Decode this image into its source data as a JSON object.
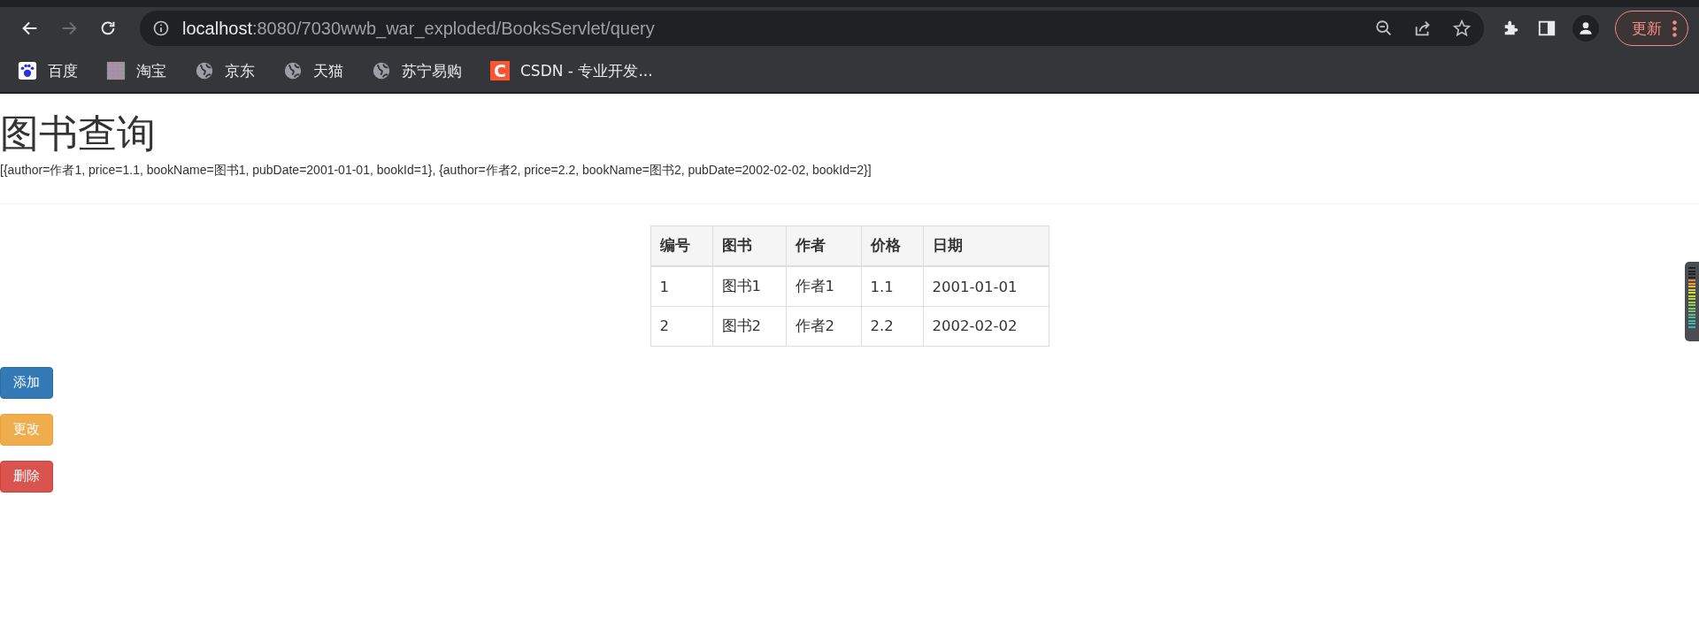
{
  "browser": {
    "address": {
      "host": "localhost",
      "path": ":8080/7030wwb_war_exploded/BooksServlet/query"
    },
    "forward_disabled": true,
    "bookmarks": [
      {
        "label": "百度",
        "kind": "paw"
      },
      {
        "label": "淘宝",
        "kind": "tile"
      },
      {
        "label": "京东",
        "kind": "globe"
      },
      {
        "label": "天猫",
        "kind": "globe"
      },
      {
        "label": "苏宁易购",
        "kind": "globe"
      },
      {
        "label": "CSDN - 专业开发...",
        "kind": "letter",
        "icon_text": "C"
      }
    ],
    "update_button": "更新"
  },
  "page": {
    "title": "图书查询",
    "dump": "[{author=作者1, price=1.1, bookName=图书1, pubDate=2001-01-01, bookId=1}, {author=作者2, price=2.2, bookName=图书2, pubDate=2002-02-02, bookId=2}]",
    "table": {
      "columns": [
        "编号",
        "图书",
        "作者",
        "价格",
        "日期"
      ],
      "rows": [
        [
          "1",
          "图书1",
          "作者1",
          "1.1",
          "2001-01-01"
        ],
        [
          "2",
          "图书2",
          "作者2",
          "2.2",
          "2002-02-02"
        ]
      ]
    },
    "buttons": [
      {
        "label": "添加",
        "kind": "primary"
      },
      {
        "label": "更改",
        "kind": "warning"
      },
      {
        "label": "删除",
        "kind": "danger"
      }
    ]
  }
}
